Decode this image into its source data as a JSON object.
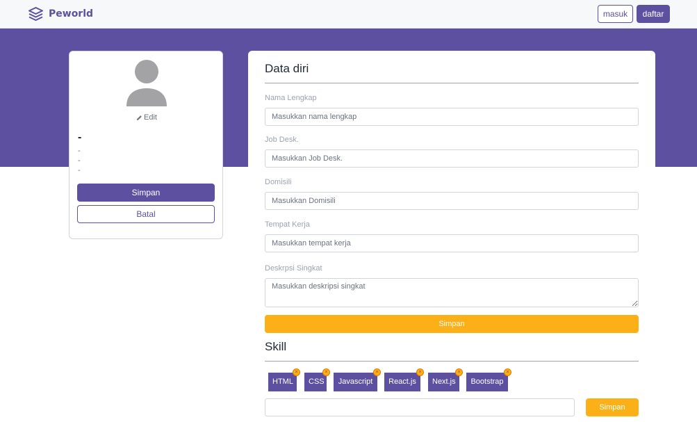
{
  "colors": {
    "brand": "#5e50a1",
    "accent": "#fbb017"
  },
  "navbar": {
    "brand": "Peworld",
    "login_label": "masuk",
    "register_label": "daftar"
  },
  "profile": {
    "edit_label": "Edit",
    "name": "-",
    "lines": [
      "-",
      "-",
      "-"
    ],
    "save_label": "Simpan",
    "cancel_label": "Batal"
  },
  "form": {
    "title": "Data diri",
    "fields": [
      {
        "label": "Nama Lengkap",
        "placeholder": "Masukkan nama lengkap"
      },
      {
        "label": "Job Desk.",
        "placeholder": "Masukkan Job Desk."
      },
      {
        "label": "Domisili",
        "placeholder": "Masukkan Domisili"
      },
      {
        "label": "Tempat Kerja",
        "placeholder": "Masukkan tempat kerja"
      },
      {
        "label": "Deskrpsi Singkat",
        "placeholder": "Masukkan deskripsi singkat"
      }
    ],
    "save_label": "Simpan"
  },
  "skill": {
    "title": "Skill",
    "items": [
      "HTML",
      "CSS",
      "Javascript",
      "React.js",
      "Next.js",
      "Bootstrap"
    ],
    "input_value": "",
    "save_label": "Simpan"
  }
}
